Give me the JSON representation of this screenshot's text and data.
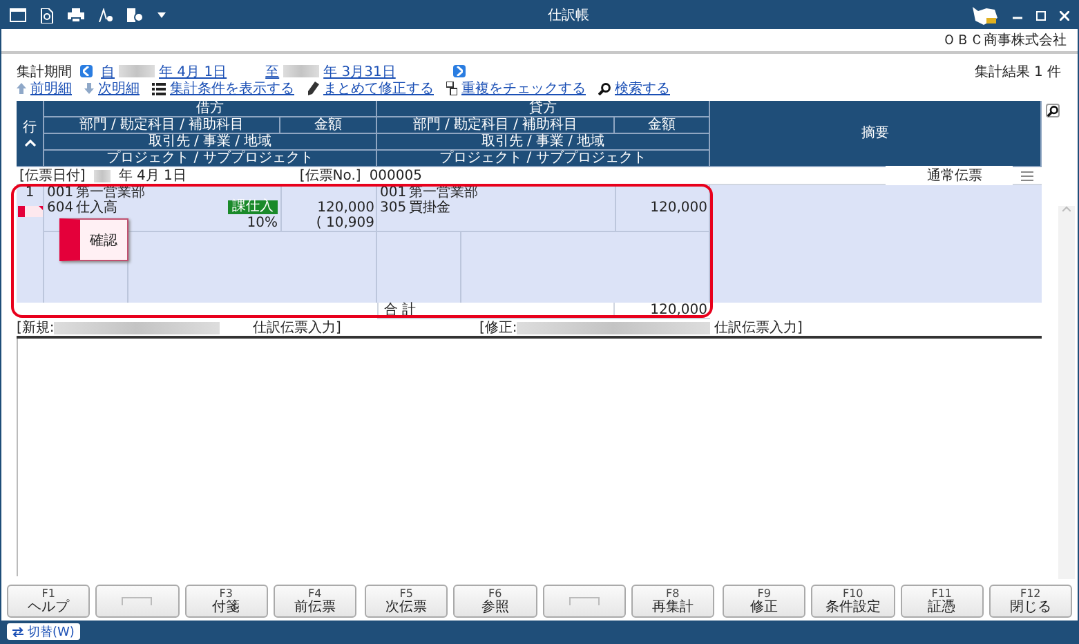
{
  "window": {
    "title": "仕訳帳",
    "company": "ＯＢＣ商事株式会社"
  },
  "period": {
    "label": "集計期間",
    "from_prefix": "自",
    "from_date": "年  4月 1日",
    "to_prefix": "至",
    "to_date": "年  3月31日",
    "result": "集計結果 1 件"
  },
  "links": [
    {
      "kind": "up",
      "label": "前明細"
    },
    {
      "kind": "down",
      "label": "次明細"
    },
    {
      "kind": "list",
      "label": "集計条件を表示する"
    },
    {
      "kind": "pencil",
      "label": "まとめて修正する"
    },
    {
      "kind": "duplicate",
      "label": "重複をチェックする"
    },
    {
      "kind": "search",
      "label": "検索する"
    }
  ],
  "table": {
    "row_header": "行",
    "debit": {
      "title": "借方",
      "line1": "部門 / 勘定科目 / 補助科目",
      "amount": "金額",
      "line2": "取引先 / 事業 / 地域",
      "line3": "プロジェクト / サブプロジェクト"
    },
    "credit": {
      "title": "貸方",
      "line1": "部門 / 勘定科目 / 補助科目",
      "amount": "金額",
      "line2": "取引先 / 事業 / 地域",
      "line3": "プロジェクト / サブプロジェクト"
    },
    "memo": "摘要"
  },
  "voucher": {
    "date_label": "[伝票日付]",
    "date": "年  4月  1日",
    "no_label": "[伝票No.]",
    "no": "000005",
    "type": "通常伝票",
    "row": "1",
    "debit": {
      "dept_code": "001",
      "dept": "第一営業部",
      "account_code": "604",
      "account": "仕入高",
      "tax_tag": "課仕入",
      "tax_rate": "10%",
      "amount": "120,000",
      "tax_amount": "( 10,909"
    },
    "credit": {
      "dept_code": "001",
      "dept": "第一営業部",
      "account_code": "305",
      "account": "買掛金",
      "amount": "120,000"
    }
  },
  "popup": {
    "label": "確認"
  },
  "totals": {
    "label": "合 計",
    "amount": "120,000"
  },
  "footer": {
    "new_label": "[新規:",
    "new_source": "仕訳伝票入力]",
    "edit_label": "[修正:",
    "edit_source": "仕訳伝票入力]"
  },
  "function_keys": [
    [
      {
        "kind": "function",
        "key": "F1",
        "label": "ヘルプ"
      },
      {
        "kind": "blank"
      },
      {
        "kind": "function",
        "key": "F3",
        "label": "付箋"
      },
      {
        "kind": "function",
        "key": "F4",
        "label": "前伝票"
      }
    ],
    [
      {
        "kind": "function",
        "key": "F5",
        "label": "次伝票"
      },
      {
        "kind": "function",
        "key": "F6",
        "label": "参照"
      },
      {
        "kind": "blank"
      },
      {
        "kind": "function",
        "key": "F8",
        "label": "再集計"
      }
    ],
    [
      {
        "kind": "function",
        "key": "F9",
        "label": "修正"
      },
      {
        "kind": "function",
        "key": "F10",
        "label": "条件設定"
      },
      {
        "kind": "function",
        "key": "F11",
        "label": "証憑"
      },
      {
        "kind": "function",
        "key": "F12",
        "label": "閉じる"
      }
    ]
  ],
  "status_bar": {
    "toggle": "切替(W)"
  }
}
